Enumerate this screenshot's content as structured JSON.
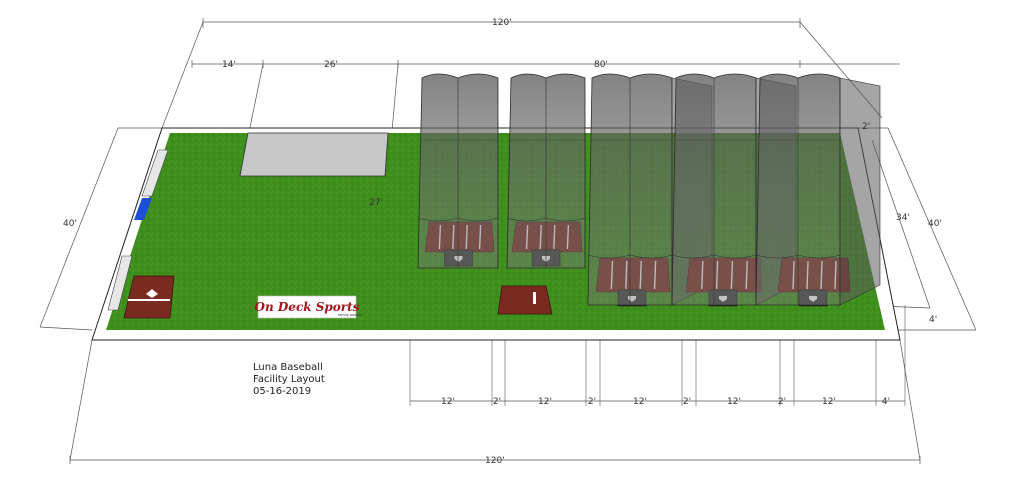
{
  "title_block": {
    "line1": "Luna Baseball",
    "line2": "Facility Layout",
    "line3": "05-16-2019"
  },
  "logo": {
    "text": "On Deck Sports",
    "subtext": "family owned"
  },
  "dimensions": {
    "overall_length_top": "120'",
    "overall_length_bottom": "120'",
    "width_left": "40'",
    "width_right": "40'",
    "segment_a": "14'",
    "segment_b": "26'",
    "segment_c": "80'",
    "cage_depth": "27'",
    "cage_length": "34'",
    "end_gap_top": "2'",
    "end_gap_bottom": "4'",
    "cage_widths": [
      "12'",
      "2'",
      "12'",
      "2'",
      "12'",
      "2'",
      "12'",
      "2'",
      "12'",
      "4'"
    ]
  },
  "colors": {
    "turf": "#3f8f1d",
    "turf_dark": "#357a17",
    "mat": "#7a2a1e",
    "net": "#6c6c6c",
    "pad": "#c7c7c7",
    "door": "#1c4fd8"
  }
}
